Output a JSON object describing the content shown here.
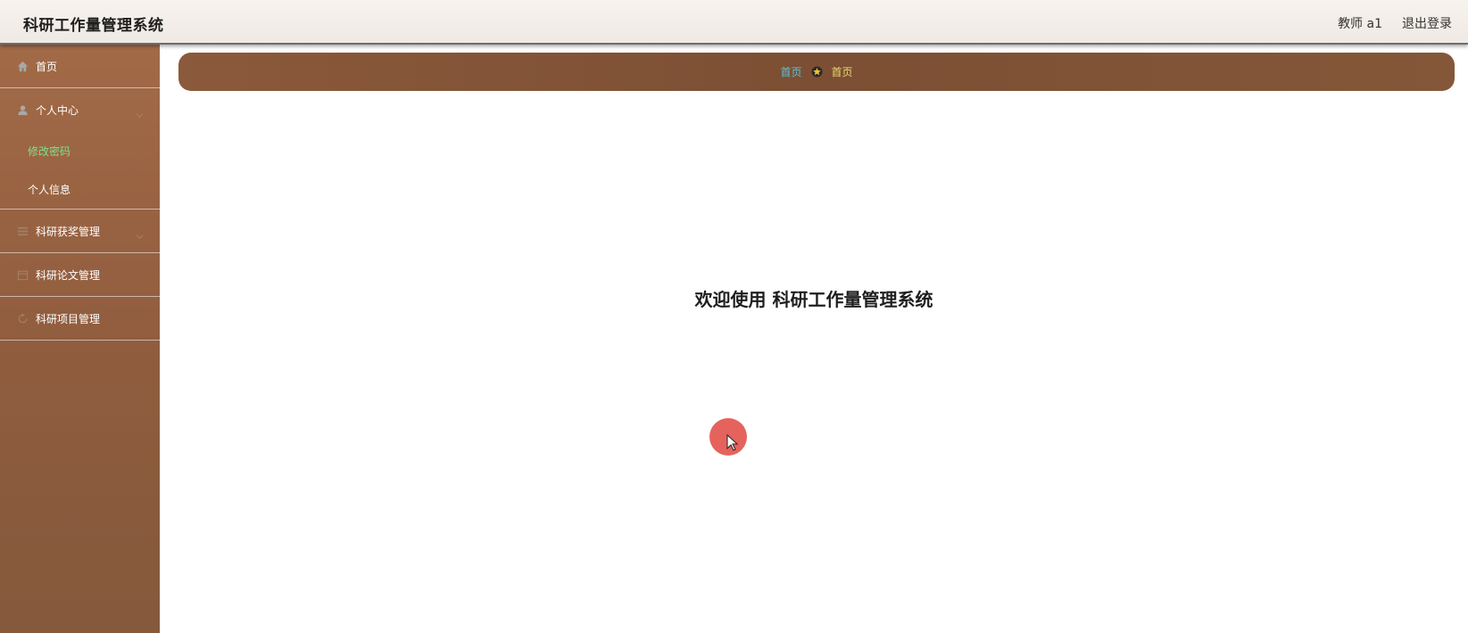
{
  "header": {
    "app_title": "科研工作量管理系统",
    "user_label": "教师 a1",
    "logout_label": "退出登录"
  },
  "sidebar": {
    "home": {
      "label": "首页",
      "icon": "home-icon"
    },
    "personal_center": {
      "label": "个人中心",
      "icon": "user-icon",
      "children": [
        {
          "label": "修改密码",
          "active": true
        },
        {
          "label": "个人信息",
          "active": false
        }
      ]
    },
    "award_mgmt": {
      "label": "科研获奖管理",
      "icon": "list-icon"
    },
    "paper_mgmt": {
      "label": "科研论文管理",
      "icon": "calendar-icon"
    },
    "project_mgmt": {
      "label": "科研项目管理",
      "icon": "refresh-icon"
    }
  },
  "breadcrumb": {
    "root": "首页",
    "current": "首页",
    "separator_icon": "star-icon"
  },
  "main": {
    "welcome_text": "欢迎使用 科研工作量管理系统"
  },
  "colors": {
    "sidebar_bg": "#8f5c3e",
    "active_sub": "#7ee08a",
    "crumb_link": "#5cc2dc",
    "crumb_current": "#e8d96c"
  }
}
